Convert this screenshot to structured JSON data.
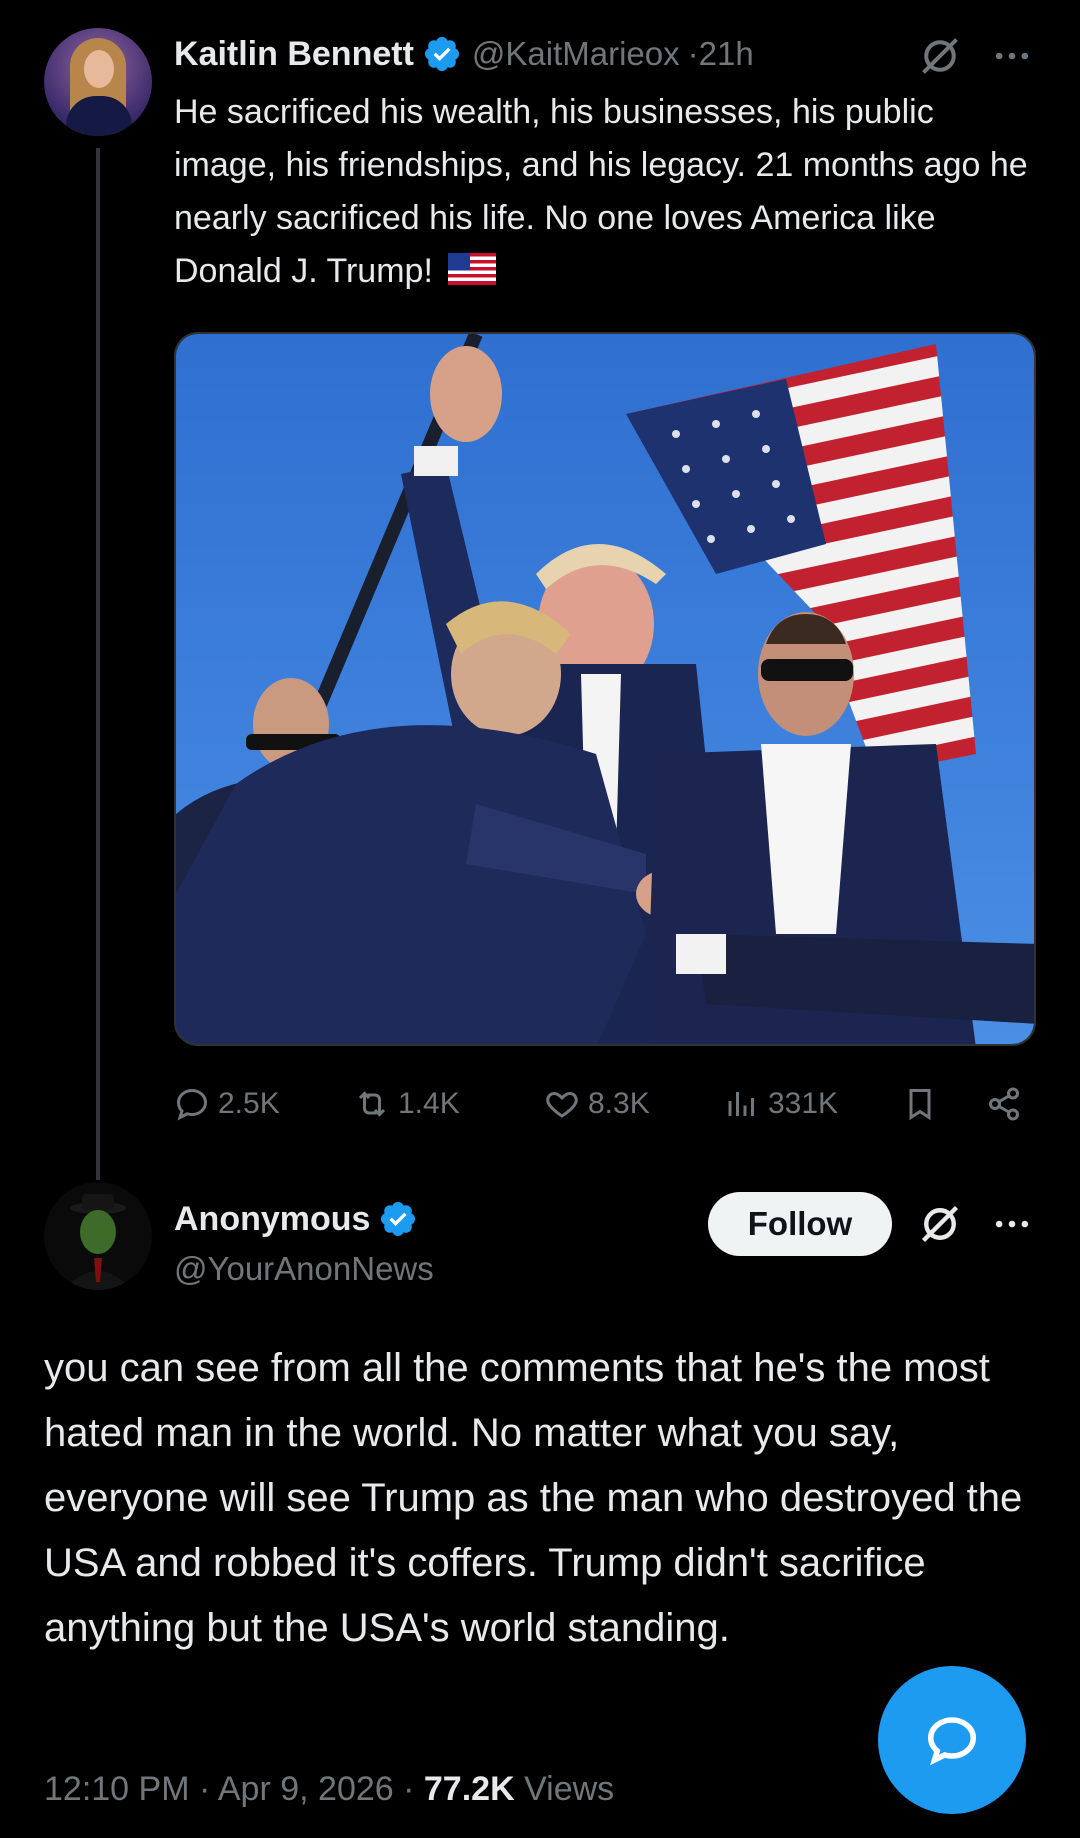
{
  "post": {
    "author_name": "Kaitlin Bennett",
    "handle": "@KaitMarieox",
    "time": "21h",
    "text": "He sacrificed his wealth, his businesses, his public image, his friendships, and his legacy. 21 months ago he nearly sacrificed his life. No one loves America like Donald J. Trump!",
    "flag_emoji": "us-flag-icon",
    "stats": {
      "replies": "2.5K",
      "reposts": "1.4K",
      "likes": "8.3K",
      "views": "331K"
    }
  },
  "reply": {
    "author_name": "Anonymous",
    "handle": "@YourAnonNews",
    "follow_label": "Follow",
    "text": "you can see from all the comments that he's the most hated man in the world. No matter what you say, everyone will see Trump as the man who destroyed the USA and robbed it's coffers. Trump didn't sacrifice anything but the USA's world standing.",
    "time": "12:10 PM",
    "date": "Apr 9, 2026",
    "views_count": "77.2K",
    "views_label": "Views",
    "separator": " · "
  },
  "colors": {
    "background": "#000000",
    "text": "#e7e9ea",
    "muted": "#71767b",
    "accent": "#1d9bf0"
  }
}
